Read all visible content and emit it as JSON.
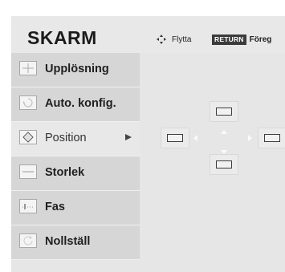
{
  "header": {
    "title": "SKARM",
    "move_hint": "Flytta",
    "return_key": "RETURN",
    "return_hint": "Föreg"
  },
  "menu": {
    "items": [
      {
        "label": "Upplösning",
        "icon": "resolution-icon"
      },
      {
        "label": "Auto. konfig.",
        "icon": "auto-config-icon"
      },
      {
        "label": "Position",
        "icon": "position-icon",
        "selected": true
      },
      {
        "label": "Storlek",
        "icon": "size-icon"
      },
      {
        "label": "Fas",
        "icon": "phase-icon"
      },
      {
        "label": "Nollställ",
        "icon": "reset-icon"
      }
    ]
  },
  "position_panel": {
    "controls": [
      "up",
      "left",
      "right",
      "down"
    ]
  },
  "colors": {
    "osd_background": "#e6e6e6",
    "menu_item": "#d6d6d6",
    "selected_item": "#e8e8e8",
    "return_key_bg": "#3b3b3b"
  }
}
